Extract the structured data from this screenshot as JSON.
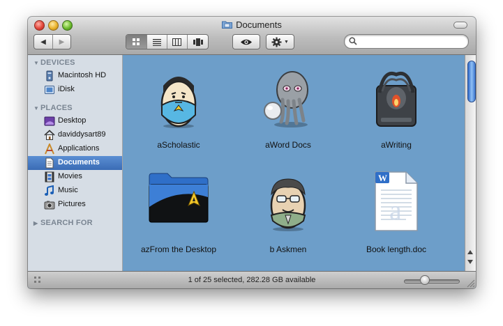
{
  "window": {
    "title": "Documents"
  },
  "toolbar": {
    "back_label": "◀",
    "forward_label": "▶",
    "view_modes": [
      "icon-view",
      "list-view",
      "column-view",
      "cover-flow-view"
    ],
    "active_view": "icon-view",
    "quicklook_icon": "eye-icon",
    "action_icon": "gear-icon",
    "search": {
      "value": "",
      "placeholder": ""
    }
  },
  "sidebar": {
    "devices": {
      "heading": "DEVICES",
      "items": [
        {
          "label": "Macintosh HD",
          "icon": "hard-drive-icon"
        },
        {
          "label": "iDisk",
          "icon": "idisk-icon"
        }
      ]
    },
    "places": {
      "heading": "PLACES",
      "items": [
        {
          "label": "Desktop",
          "icon": "desktop-icon"
        },
        {
          "label": "daviddysart89",
          "icon": "home-icon"
        },
        {
          "label": "Applications",
          "icon": "applications-icon"
        },
        {
          "label": "Documents",
          "icon": "documents-icon",
          "selected": true
        },
        {
          "label": "Movies",
          "icon": "movies-icon"
        },
        {
          "label": "Music",
          "icon": "music-icon"
        },
        {
          "label": "Pictures",
          "icon": "pictures-icon"
        }
      ]
    },
    "search_for": {
      "heading": "SEARCH FOR"
    }
  },
  "files": [
    {
      "name": "aScholastic",
      "icon": "spock-egg-icon"
    },
    {
      "name": "aWord Docs",
      "icon": "cthulhu-icon"
    },
    {
      "name": "aWriting",
      "icon": "dark-drive-icon"
    },
    {
      "name": "azFrom the Desktop",
      "icon": "starfleet-folder-icon"
    },
    {
      "name": "b Askmen",
      "icon": "glasses-egg-icon"
    },
    {
      "name": "Book length.doc",
      "icon": "word-document-icon"
    }
  ],
  "status": {
    "text": "1 of 25 selected, 282.28 GB available",
    "icon_size": 0.35
  },
  "colors": {
    "content_background": "#6d9ec9",
    "selection": "#3a6cb5",
    "sidebar_background": "#d6dde5"
  }
}
